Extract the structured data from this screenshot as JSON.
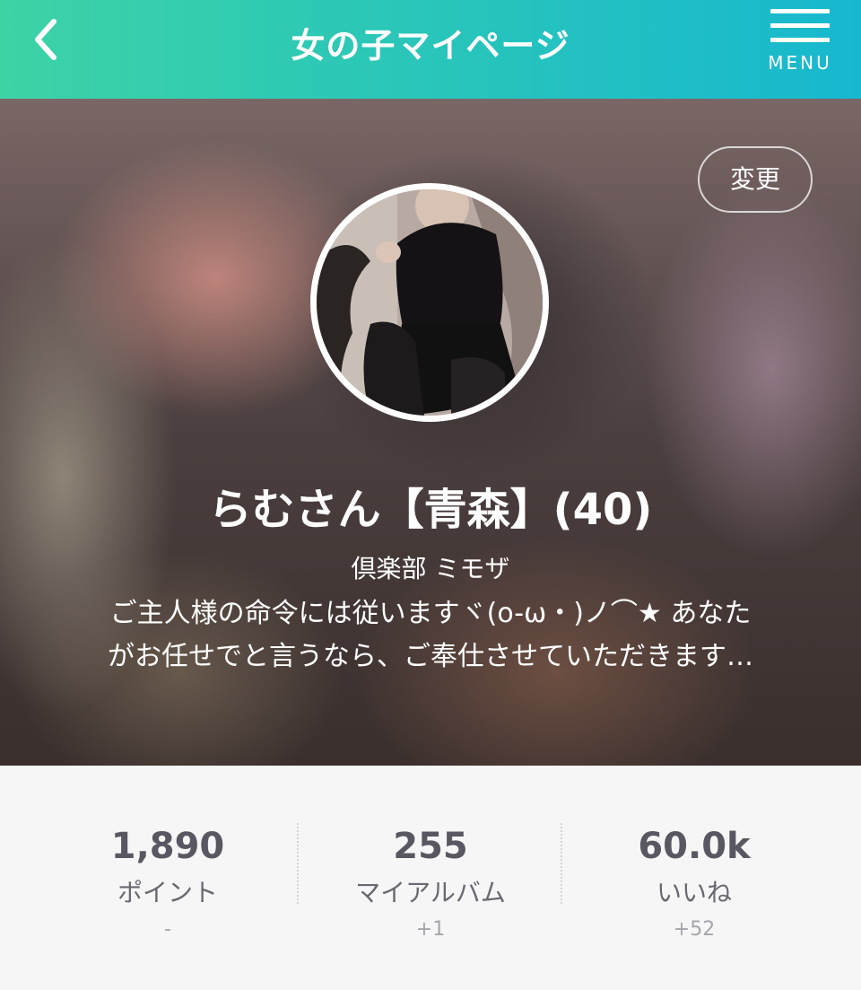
{
  "header": {
    "title": "女の子マイページ",
    "menu_label": "MENU"
  },
  "profile": {
    "change_label": "変更",
    "name": "らむさん【青森】(40)",
    "shop": "倶楽部 ミモザ",
    "bio_line1": "ご主人様の命令には従いますヾ(o-ω・)ノ⌒★ あなた",
    "bio_line2": "がお任せでと言うなら、ご奉仕させていただきます…"
  },
  "stats": [
    {
      "value": "1,890",
      "label": "ポイント",
      "delta": "-"
    },
    {
      "value": "255",
      "label": "マイアルバム",
      "delta": "+1"
    },
    {
      "value": "60.0k",
      "label": "いいね",
      "delta": "+52"
    }
  ],
  "colors": {
    "header_start": "#3dd3a5",
    "header_end": "#17b8cf",
    "stat_text": "#595761"
  }
}
